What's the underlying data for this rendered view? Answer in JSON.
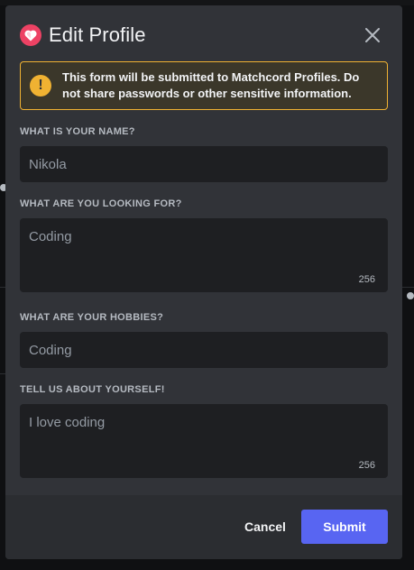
{
  "modal": {
    "title": "Edit Profile",
    "app_icon": "heart-icon",
    "close_icon": "close-icon"
  },
  "warning": {
    "icon": "exclamation-icon",
    "text": "This form will be submitted to Matchcord Profiles. Do not share passwords or other sensitive information."
  },
  "fields": [
    {
      "label": "WHAT IS YOUR NAME?",
      "placeholder": "Nikola"
    },
    {
      "label": "WHAT ARE YOU LOOKING FOR?",
      "placeholder": "Coding",
      "counter": "256"
    },
    {
      "label": "WHAT ARE YOUR HOBBIES?",
      "placeholder": "Coding"
    },
    {
      "label": "TELL US ABOUT YOURSELF!",
      "placeholder": "I love coding",
      "counter": "256"
    }
  ],
  "footer": {
    "cancel_label": "Cancel",
    "submit_label": "Submit"
  },
  "colors": {
    "accent": "#5865f2",
    "warning": "#f0b232",
    "brand": "#ed4264"
  }
}
